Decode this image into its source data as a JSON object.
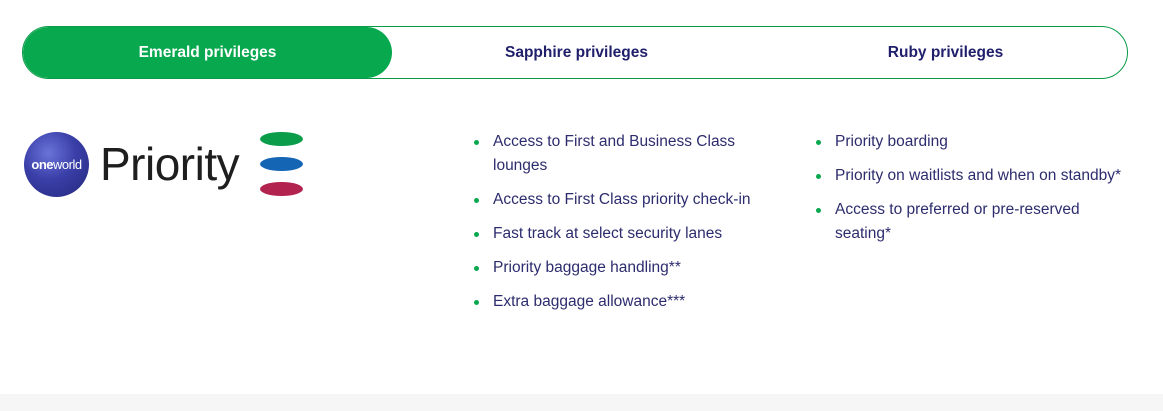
{
  "tabs": [
    {
      "label": "Emerald privileges",
      "active": true
    },
    {
      "label": "Sapphire privileges",
      "active": false
    },
    {
      "label": "Ruby privileges",
      "active": false
    }
  ],
  "logo": {
    "badge_text_bold": "one",
    "badge_text_regular": "world",
    "word": "Priority",
    "bar_colors": [
      "#0b9d4a",
      "#1466b5",
      "#b3234f"
    ]
  },
  "privileges_left": [
    "Access to First and Business Class lounges",
    "Access to First Class priority check-in",
    "Fast track at select security lanes",
    "Priority baggage handling**",
    "Extra baggage allowance***"
  ],
  "privileges_right": [
    "Priority boarding",
    "Priority on waitlists and when on standby*",
    "Access to preferred or pre-reserved seating*"
  ],
  "colors": {
    "accent_green": "#08a84f",
    "text_navy": "#2c2c6e",
    "tab_text": "#1f1f6b"
  }
}
